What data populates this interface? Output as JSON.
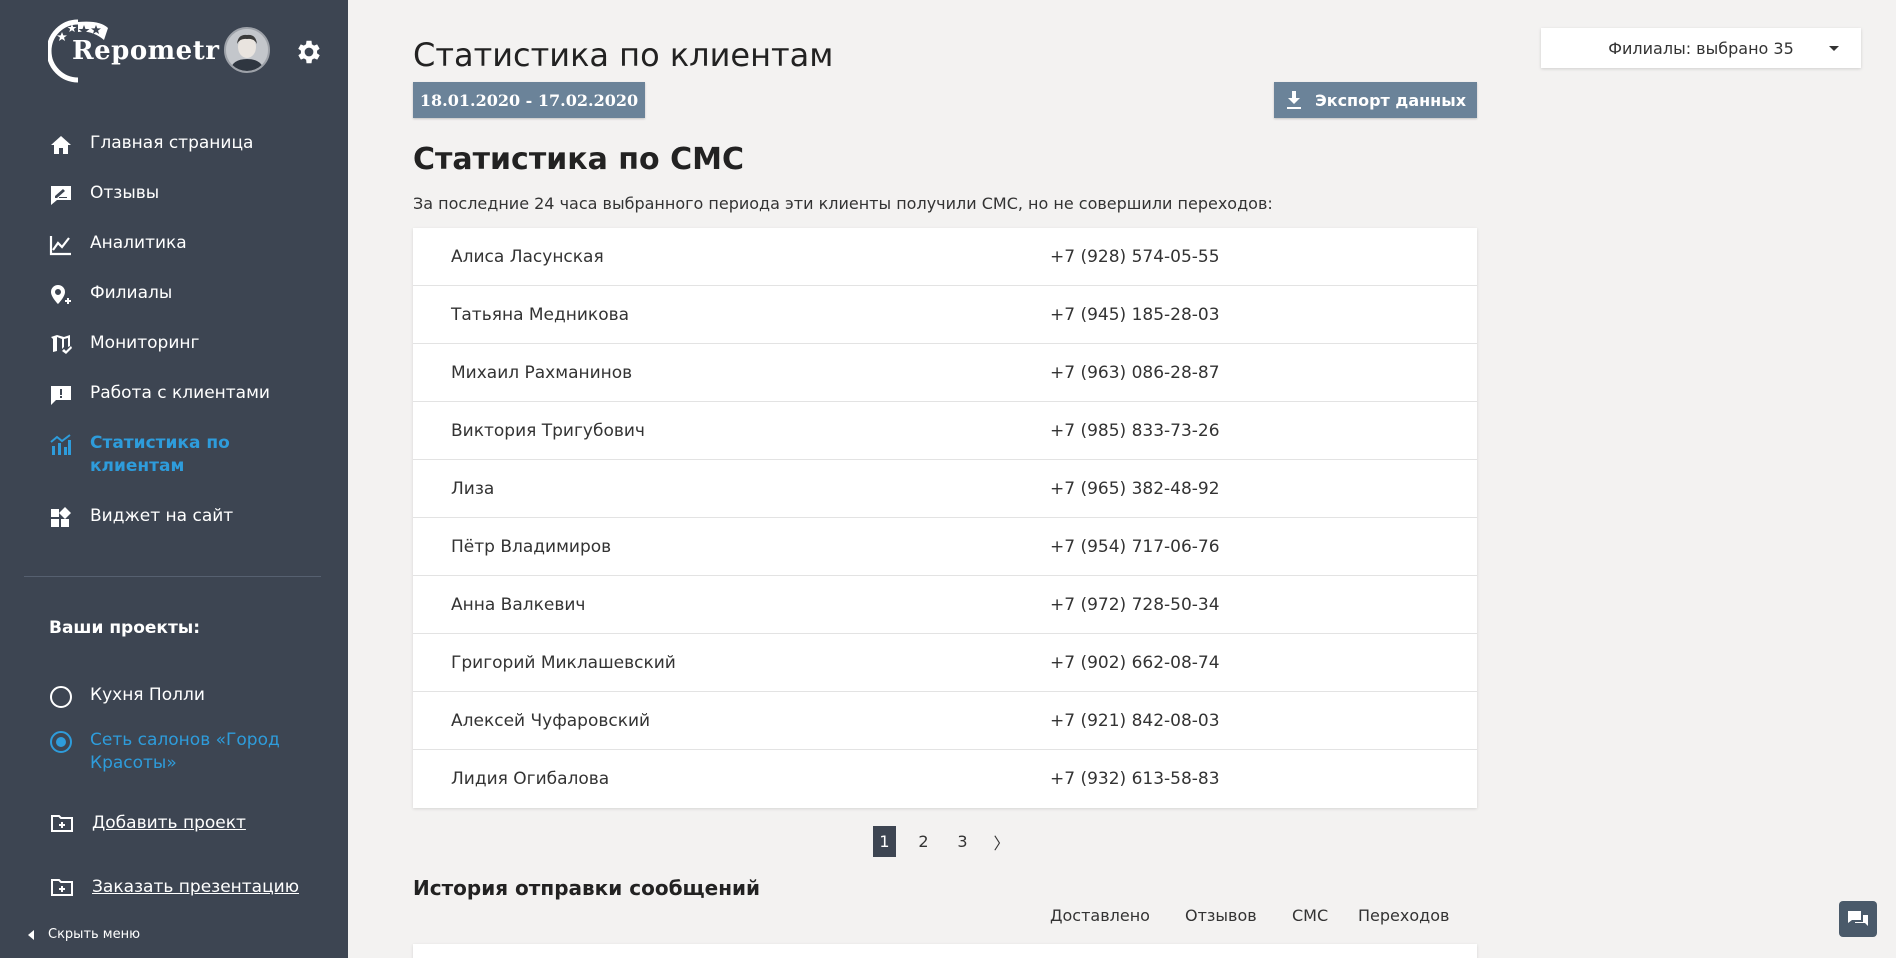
{
  "app": {
    "logo_text": "Repometr"
  },
  "nav": {
    "items": [
      {
        "label": "Главная страница",
        "icon": "home-icon"
      },
      {
        "label": "Отзывы",
        "icon": "review-edit-icon"
      },
      {
        "label": "Аналитика",
        "icon": "analytics-icon"
      },
      {
        "label": "Филиалы",
        "icon": "location-add-icon"
      },
      {
        "label": "Мониторинг",
        "icon": "map-check-icon"
      },
      {
        "label": "Работа с клиентами",
        "icon": "feedback-icon"
      },
      {
        "label": "Статистика по клиентам",
        "icon": "stats-icon",
        "active": true
      },
      {
        "label": "Виджет на сайт",
        "icon": "widget-icon"
      }
    ]
  },
  "projects": {
    "title": "Ваши проекты:",
    "items": [
      {
        "label": "Кухня Полли",
        "selected": false
      },
      {
        "label": "Сеть салонов «Город Красоты»",
        "selected": true
      }
    ],
    "add_label": "Добавить проект",
    "presentation_label": "Заказать презентацию"
  },
  "hide_menu_label": "Скрыть меню",
  "header": {
    "title": "Статистика по клиентам",
    "date_range": "18.01.2020 - 17.02.2020",
    "export_label": "Экспорт данных",
    "branches_label": "Филиалы: выбрано 35"
  },
  "sms": {
    "title": "Статистика по СМС",
    "description": "За последние 24 часа выбранного периода эти клиенты получили СМС, но не совершили переходов:",
    "rows": [
      {
        "name": "Алиса Ласунская",
        "phone": "+7 (928) 574-05-55"
      },
      {
        "name": "Татьяна Медникова",
        "phone": "+7 (945) 185-28-03"
      },
      {
        "name": "Михаил Рахманинов",
        "phone": "+7 (963) 086-28-87"
      },
      {
        "name": "Виктория Тригубович",
        "phone": "+7 (985) 833-73-26"
      },
      {
        "name": "Лиза",
        "phone": "+7 (965) 382-48-92"
      },
      {
        "name": "Пётр Владимиров",
        "phone": "+7 (954) 717-06-76"
      },
      {
        "name": "Анна Валкевич",
        "phone": "+7 (972) 728-50-34"
      },
      {
        "name": "Григорий Миклашевский",
        "phone": "+7 (902) 662-08-74"
      },
      {
        "name": "Алексей Чуфаровский",
        "phone": "+7 (921) 842-08-03"
      },
      {
        "name": "Лидия Огибалова",
        "phone": "+7 (932) 613-58-83"
      }
    ]
  },
  "pagination": {
    "pages": [
      "1",
      "2",
      "3"
    ],
    "current": "1",
    "next_label": "〉"
  },
  "history": {
    "title": "История отправки сообщений",
    "columns": [
      "Доставлено",
      "Отзывов",
      "СМС",
      "Переходов"
    ]
  },
  "colors": {
    "sidebar_bg": "#3d4552",
    "accent": "#2e9cdb",
    "button_bg": "#6b8399",
    "page_bg": "#f3f2f1"
  }
}
